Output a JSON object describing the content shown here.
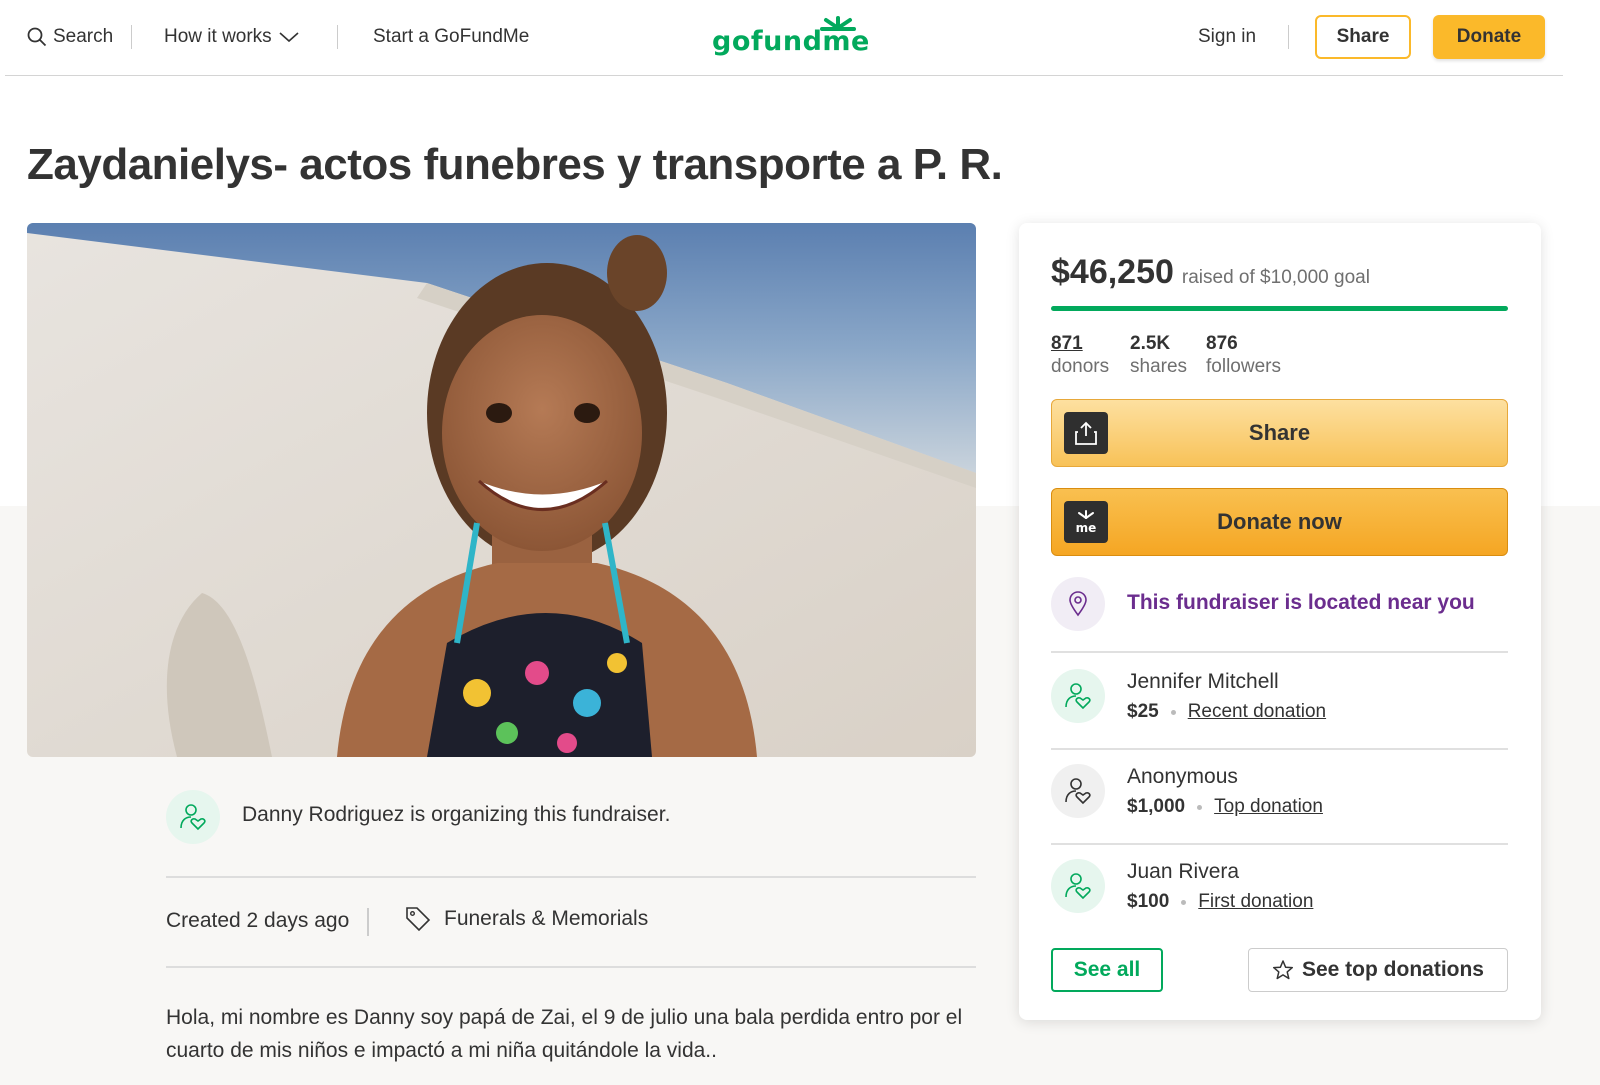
{
  "header": {
    "search_label": "Search",
    "how_it_works_label": "How it works",
    "start_label": "Start a GoFundMe",
    "logo_text": "gofundme",
    "sign_in_label": "Sign in",
    "share_label": "Share",
    "donate_label": "Donate"
  },
  "campaign": {
    "title": "Zaydanielys- actos funebres y transporte a P. R.",
    "organizer_text": "Danny Rodriguez is organizing this fundraiser.",
    "created": "Created 2 days ago",
    "category": "Funerals & Memorials",
    "story": "Hola, mi nombre es Danny soy papá de Zai, el 9 de julio una bala perdida entro por el cuarto de mis niños e impactó a mi niña quitándole la vida.."
  },
  "sidebar": {
    "raised_amount": "$46,250",
    "raised_goal_text": "raised of $10,000 goal",
    "progress_fraction": 1.0,
    "stats": [
      {
        "num": "871",
        "label": "donors"
      },
      {
        "num": "2.5K",
        "label": "shares"
      },
      {
        "num": "876",
        "label": "followers"
      }
    ],
    "share_button": "Share",
    "donate_button": "Donate now",
    "donate_icon_text": "me",
    "near_text": "This fundraiser is located near you",
    "donations": [
      {
        "name": "Jennifer Mitchell",
        "amount": "$25",
        "type": "Recent donation"
      },
      {
        "name": "Anonymous",
        "amount": "$1,000",
        "type": "Top donation"
      },
      {
        "name": "Juan Rivera",
        "amount": "$100",
        "type": "First donation"
      }
    ],
    "see_all": "See all",
    "see_top": "See top donations"
  },
  "colors": {
    "brand_green": "#02a95c",
    "donate_yellow": "#fbb92a",
    "near_purple": "#6b2d8e"
  },
  "icons": [
    "search-icon",
    "chevron-down-icon",
    "share-upload-icon",
    "gofundme-me-icon",
    "location-pin-icon",
    "donor-heart-icon",
    "tag-icon",
    "star-icon"
  ]
}
